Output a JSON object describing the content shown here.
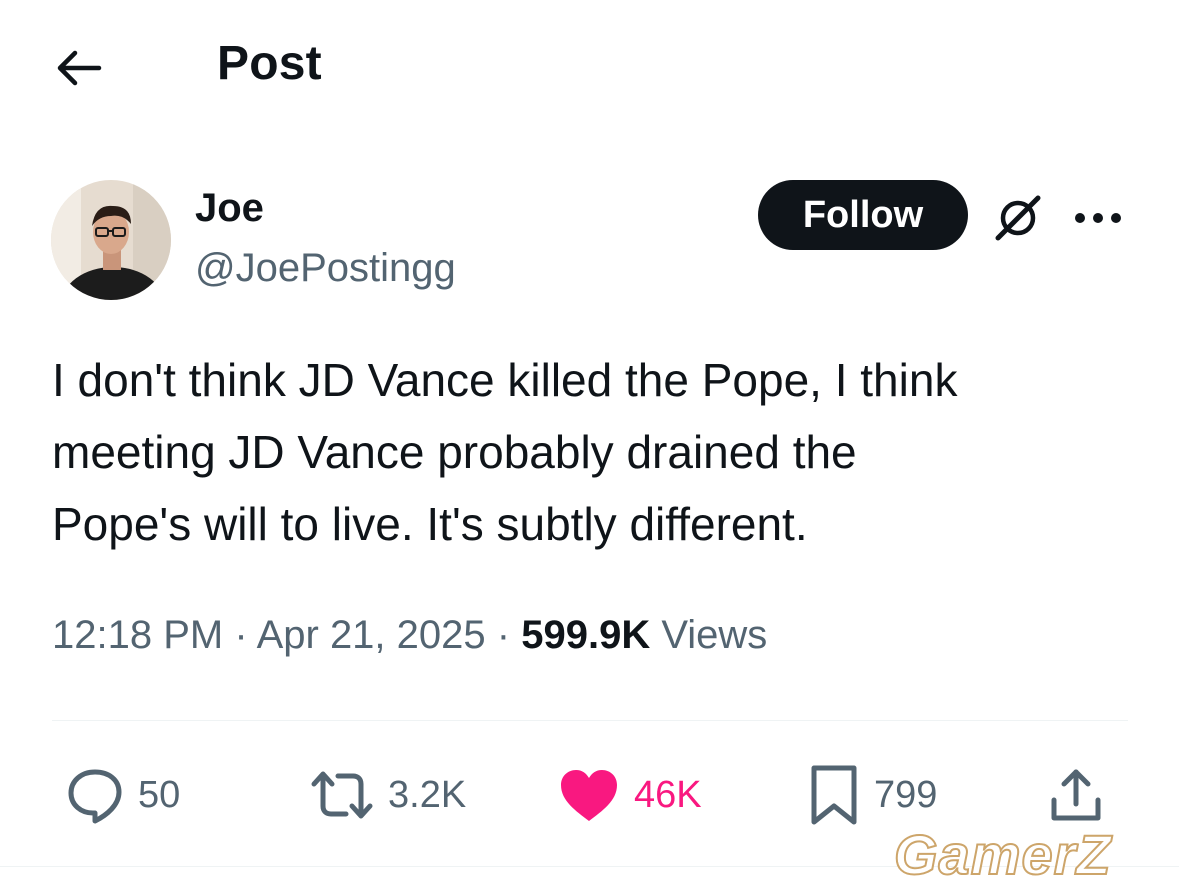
{
  "header": {
    "title": "Post",
    "back_icon": "arrow-left-icon"
  },
  "author": {
    "display_name": "Joe",
    "handle": "@JoePostingg",
    "follow_label": "Follow",
    "grok_icon": "grok-icon",
    "more_icon": "more-horizontal-icon"
  },
  "tweet": {
    "text": "I don't think JD Vance killed the Pope, I think\nmeeting JD Vance probably drained the\nPope's will to live. It's subtly different."
  },
  "meta": {
    "time": "12:18 PM",
    "separator": "·",
    "date": "Apr 21, 2025",
    "views_count": "599.9K",
    "views_label": "Views"
  },
  "actions": {
    "replies": "50",
    "reposts": "3.2K",
    "likes": "46K",
    "bookmarks": "799"
  },
  "colors": {
    "text_primary": "#0f1419",
    "text_secondary": "#536471",
    "like_pink": "#f91880",
    "follow_bg": "#0f1419"
  },
  "watermark": {
    "text": "GamerZ"
  }
}
